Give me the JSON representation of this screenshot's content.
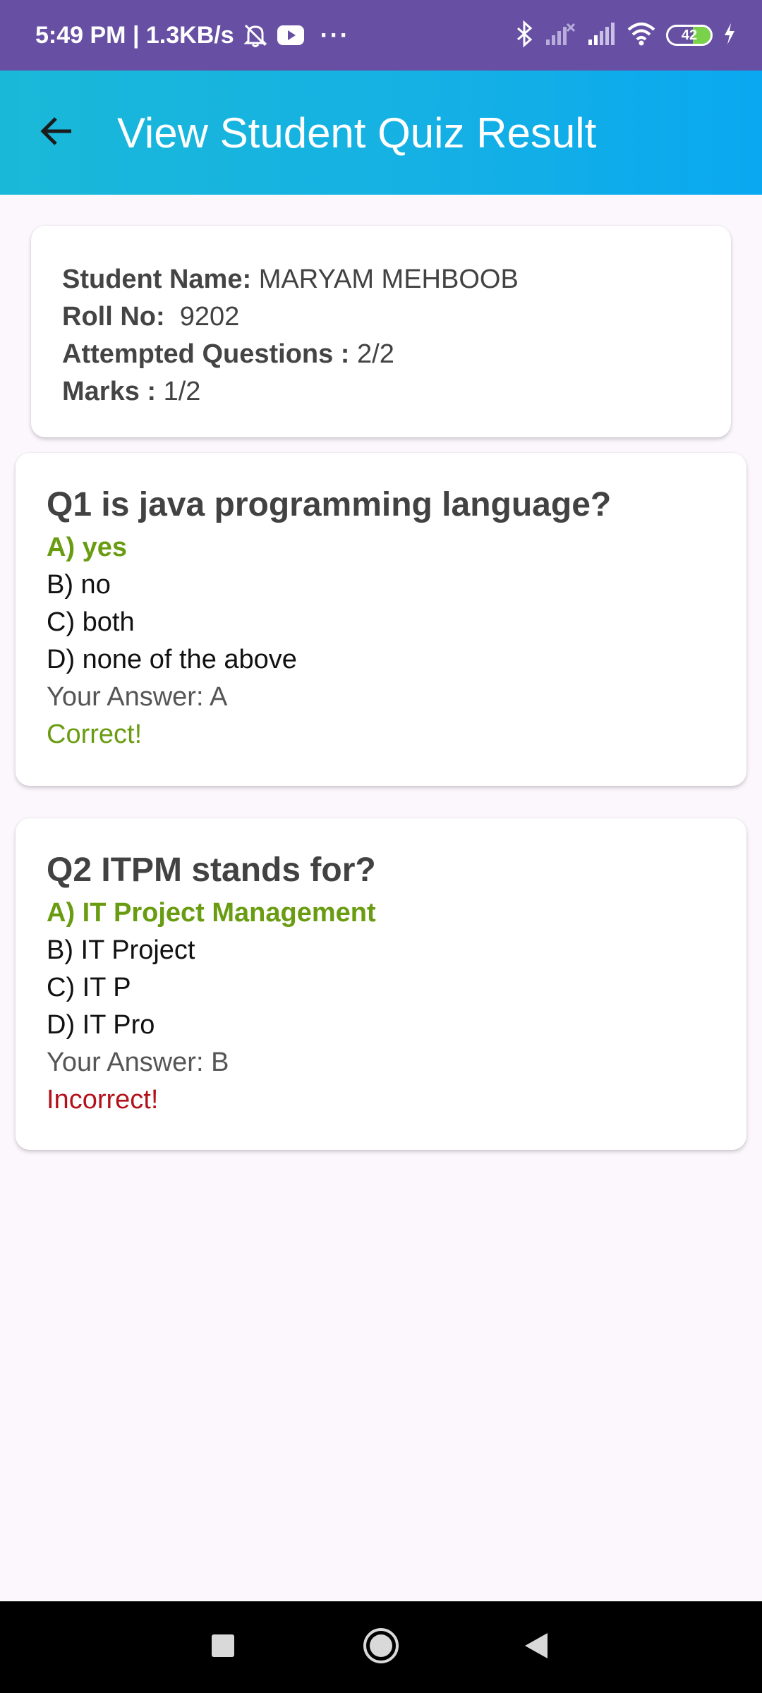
{
  "status_bar": {
    "time_speed": "5:49 PM | 1.3KB/s",
    "more": "···",
    "battery_level": "42",
    "battery_fraction": 0.42,
    "icons": [
      "alarm-off-icon",
      "youtube-icon",
      "bluetooth-icon",
      "signal-off-icon",
      "signal-icon",
      "wifi-icon",
      "battery-icon",
      "charging-icon"
    ]
  },
  "app_bar": {
    "title": "View Student Quiz Result",
    "back_icon": "arrow-back-icon"
  },
  "student": {
    "name_label": "Student Name:",
    "name_value": " MARYAM MEHBOOB",
    "roll_label": "Roll No:",
    "roll_value": "  9202",
    "attempted_label": "Attempted Questions :",
    "attempted_value": " 2/2",
    "marks_label": "Marks :",
    "marks_value": " 1/2"
  },
  "questions": [
    {
      "title": "Q1 is java programming language?",
      "options": [
        "A) yes",
        "B) no",
        "C) both",
        "D) none of the above"
      ],
      "your_answer": "Your Answer: A",
      "result": "Correct!"
    },
    {
      "title": "Q2 ITPM stands for?",
      "options": [
        "A) IT Project Management",
        "B) IT Project",
        "C) IT P",
        "D) IT Pro"
      ],
      "your_answer": "Your Answer: B",
      "result": "Incorrect!"
    }
  ],
  "colors": {
    "status_bar": "#6750a4",
    "app_bar_start": "#1ab8d8",
    "app_bar_end": "#0aa8f0",
    "correct": "#6a9c12",
    "incorrect": "#b3121b",
    "background": "#fcf6fd"
  },
  "nav_bar": {
    "icons": [
      "recent-apps-icon",
      "home-icon",
      "back-icon"
    ]
  }
}
